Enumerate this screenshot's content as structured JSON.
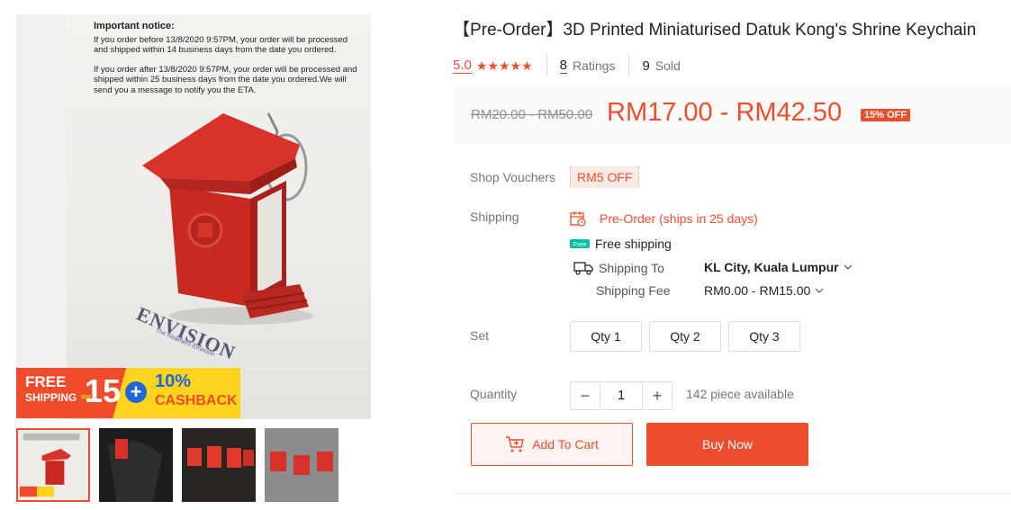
{
  "product": {
    "title": "【Pre-Order】3D Printed Miniaturised Datuk Kong's Shrine Keychain",
    "rating": "5.0",
    "stars": "★★★★★",
    "ratings_count": "8",
    "ratings_label": "Ratings",
    "sold_count": "9",
    "sold_label": "Sold"
  },
  "price": {
    "original": "RM20.00 - RM50.00",
    "current": "RM17.00 - RM42.50",
    "discount_badge": "15% OFF"
  },
  "vouchers": {
    "label": "Shop Vouchers",
    "voucher": "RM5 OFF"
  },
  "shipping": {
    "label": "Shipping",
    "preorder": "Pre-Order (ships in 25 days)",
    "free_badge": "Free",
    "free_shipping": "Free shipping",
    "to_label": "Shipping To",
    "to_value": "KL City, Kuala Lumpur",
    "fee_label": "Shipping Fee",
    "fee_value": "RM0.00 - RM15.00"
  },
  "variations": {
    "label": "Set",
    "options": [
      "Qty 1",
      "Qty 2",
      "Qty 3"
    ]
  },
  "quantity": {
    "label": "Quantity",
    "value": "1",
    "minus": "−",
    "plus": "+",
    "available": "142 piece available"
  },
  "actions": {
    "add_to_cart": "Add To Cart",
    "buy_now": "Buy Now"
  },
  "gallery": {
    "notice_title": "Important notice:",
    "notice_p1": "If you order before 13/8/2020 9:57PM, your order will be processed and shipped within 14 business days from the date you ordered.",
    "notice_p2": "If you order after 13/8/2020 9:57PM, your order will be processed and shipped within 25 business days from the date you ordered.We will send you a message to notify you the ETA.",
    "watermark": "ENVISION",
    "watermark_sub": "The Reamers Envision",
    "promo": {
      "free": "FREE",
      "shipping": "SHIPPING",
      "rm": "RM",
      "amount": "15",
      "plus": "+",
      "percent": "10%",
      "cashback": "CASHBACK"
    }
  },
  "colors": {
    "accent": "#ee4d2d",
    "shrine_red": "#d8322a",
    "promo_yellow": "#ffd31e",
    "promo_blue": "#1f66d6"
  }
}
